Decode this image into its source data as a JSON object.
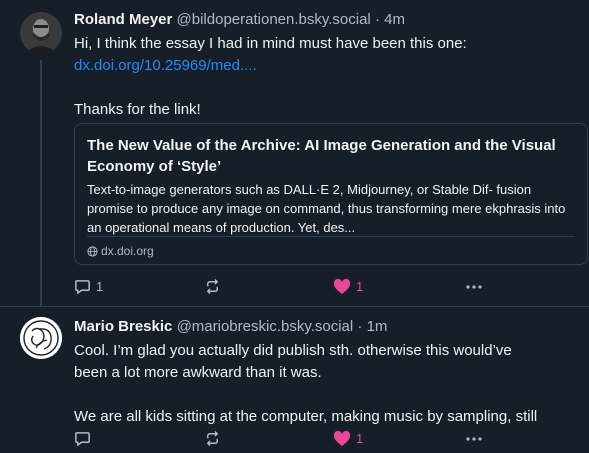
{
  "posts": [
    {
      "author": {
        "name": "Roland Meyer",
        "handle": "@bildoperationen.bsky.social",
        "time": "4m"
      },
      "text": {
        "line1": "Hi, I think the essay I had in mind must have been this one:",
        "link": "dx.doi.org/10.25969/med....",
        "line3": "Thanks for the link!"
      },
      "card": {
        "title": "The New Value of the Archive: AI Image Generation and the Visual Economy of ‘Style’",
        "description": "Text-to-image generators such as DALL·E 2, Midjourney, or Stable Dif- fusion promise to produce any image on command, thus transforming mere ekphrasis into an operational means of production. Yet, des...",
        "source": "dx.doi.org"
      },
      "actions": {
        "reply_count": "1",
        "repost_count": "",
        "like_count": "1"
      }
    },
    {
      "author": {
        "name": "Mario Breskic",
        "handle": "@mariobreskic.bsky.social",
        "time": "1m"
      },
      "text": {
        "line1": "Cool. I’m glad you actually did publish sth. otherwise this would’ve",
        "line2": "been a lot more awkward than it was.",
        "line3": "We are all kids sitting at the computer, making music by sampling, still"
      },
      "actions": {
        "reply_count": "",
        "repost_count": "",
        "like_count": "1"
      }
    }
  ],
  "icons": {
    "reply": "speech-bubble-icon",
    "repost": "repost-arrows-icon",
    "like": "heart-icon",
    "more": "ellipsis-icon",
    "globe": "globe-icon"
  },
  "colors": {
    "background": "#161e27",
    "text": "#f1f3f5",
    "muted": "#aebbc9",
    "link": "#208bfe",
    "like": "#ec4899",
    "border": "#2e4052"
  }
}
